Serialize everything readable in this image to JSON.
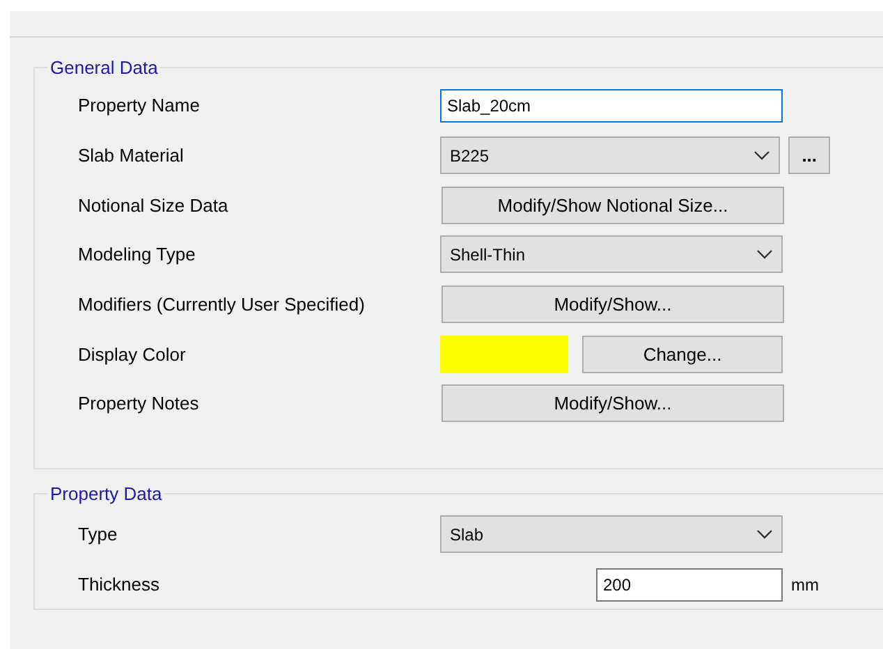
{
  "groups": [
    {
      "title": "General Data",
      "rows": [
        {
          "label": "Property Name",
          "kind": "text",
          "value": "Slab_20cm",
          "focused": true
        },
        {
          "label": "Slab Material",
          "kind": "dropdown",
          "value": "B225",
          "extra_button": "..."
        },
        {
          "label": "Notional Size Data",
          "kind": "button",
          "button": "Modify/Show Notional Size..."
        },
        {
          "label": "Modeling Type",
          "kind": "dropdown",
          "value": "Shell-Thin"
        },
        {
          "label": "Modifiers (Currently User Specified)",
          "kind": "button",
          "button": "Modify/Show..."
        },
        {
          "label": "Display Color",
          "kind": "color",
          "color": "#ffff00",
          "button": "Change..."
        },
        {
          "label": "Property Notes",
          "kind": "button",
          "button": "Modify/Show..."
        }
      ]
    },
    {
      "title": "Property Data",
      "rows": [
        {
          "label": "Type",
          "kind": "dropdown",
          "value": "Slab"
        },
        {
          "label": "Thickness",
          "kind": "number",
          "value": "200",
          "unit": "mm"
        }
      ]
    }
  ]
}
